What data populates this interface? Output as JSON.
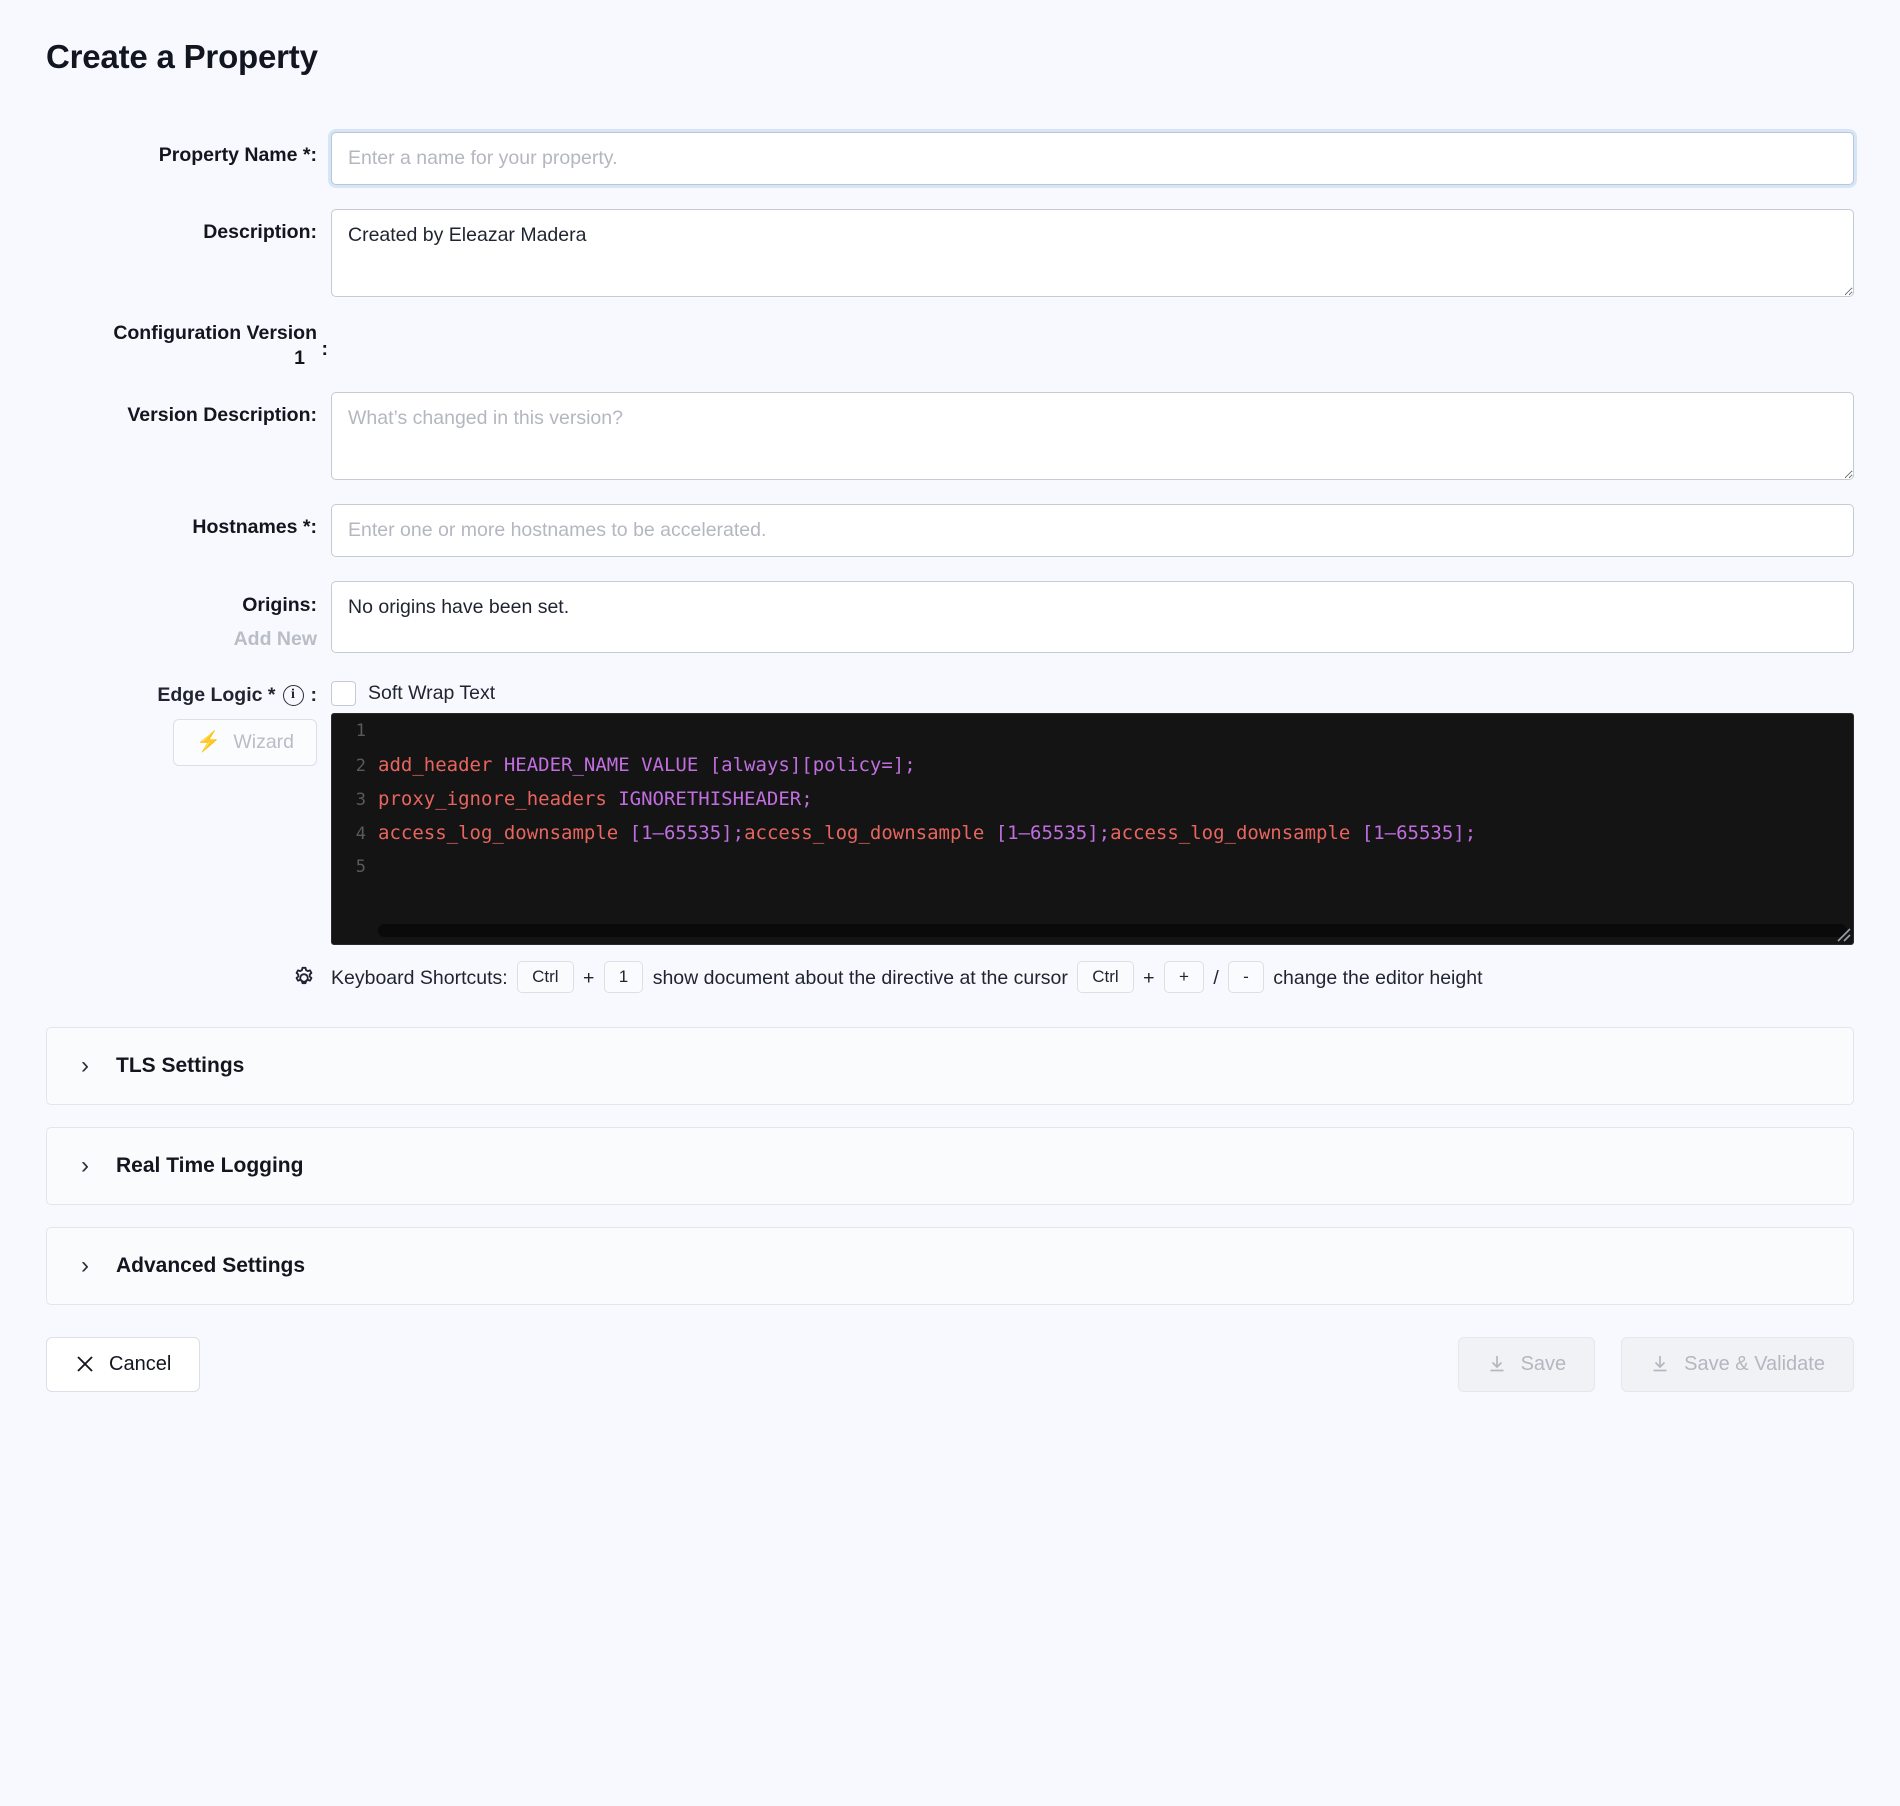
{
  "page": {
    "title": "Create a Property"
  },
  "form": {
    "property_name": {
      "label": "Property Name *",
      "colon": ":",
      "value": "",
      "placeholder": "Enter a name for your property."
    },
    "description": {
      "label": "Description",
      "colon": ":",
      "value": "Created by Eleazar Madera",
      "placeholder": ""
    },
    "configuration_version": {
      "label": "Configuration Version",
      "colon": ":",
      "value": "1"
    },
    "version_description": {
      "label": "Version Description",
      "colon": ":",
      "value": "",
      "placeholder": "What’s changed in this version?"
    },
    "hostnames": {
      "label": "Hostnames *",
      "colon": ":",
      "value": "",
      "placeholder": "Enter one or more hostnames to be accelerated."
    },
    "origins": {
      "label": "Origins",
      "colon": ":",
      "add_new": "Add New",
      "empty_text": "No origins have been set."
    },
    "edge_logic": {
      "label": "Edge Logic *",
      "colon": ":",
      "info_icon": "info-icon",
      "soft_wrap_label": "Soft Wrap Text",
      "soft_wrap_checked": false,
      "wizard_label": "Wizard",
      "wizard_icon": "lightning-bolt-icon",
      "wizard_disabled": true
    }
  },
  "editor": {
    "lines": [
      {
        "num": "1",
        "tokens": []
      },
      {
        "num": "2",
        "tokens": [
          {
            "t": "add_header ",
            "c": "dir"
          },
          {
            "t": "HEADER_NAME VALUE [always][policy=];",
            "c": "arg"
          }
        ]
      },
      {
        "num": "3",
        "tokens": [
          {
            "t": "proxy_ignore_headers ",
            "c": "dir"
          },
          {
            "t": "IGNORETHISHEADER;",
            "c": "arg"
          }
        ]
      },
      {
        "num": "4",
        "tokens": [
          {
            "t": "access_log_downsample ",
            "c": "dir"
          },
          {
            "t": "[1–65535];",
            "c": "arg"
          },
          {
            "t": "access_log_downsample ",
            "c": "dir"
          },
          {
            "t": "[1–65535];",
            "c": "arg"
          },
          {
            "t": "access_log_downsample ",
            "c": "dir"
          },
          {
            "t": "[1–65535];",
            "c": "arg"
          }
        ]
      },
      {
        "num": "5",
        "tokens": []
      }
    ],
    "colors": {
      "background": "#141414",
      "directive": "#e8655f",
      "argument": "#c06ee0",
      "gutter": "#5a5a5a"
    }
  },
  "shortcuts": {
    "gear_icon": "gear-icon",
    "prefix": "Keyboard Shortcuts:",
    "key_ctrl_1_a": "Ctrl",
    "plus_a": "+",
    "key_1": "1",
    "desc_a": "show document about the directive at the cursor",
    "key_ctrl_2": "Ctrl",
    "plus_b": "+",
    "key_plus": "+",
    "slash": "/",
    "key_minus": "-",
    "desc_b": "change the editor height"
  },
  "accordions": [
    {
      "label": "TLS Settings",
      "icon": "chevron-right-icon",
      "expanded": false
    },
    {
      "label": "Real Time Logging",
      "icon": "chevron-right-icon",
      "expanded": false
    },
    {
      "label": "Advanced Settings",
      "icon": "chevron-right-icon",
      "expanded": false
    }
  ],
  "footer": {
    "cancel": {
      "label": "Cancel",
      "icon": "close-x-icon",
      "disabled": false
    },
    "save": {
      "label": "Save",
      "icon": "download-icon",
      "disabled": true
    },
    "save_validate": {
      "label": "Save & Validate",
      "icon": "download-icon",
      "disabled": true
    }
  },
  "colors": {
    "page_background": "#f8f9fe",
    "focus_ring": "#d6e6f7",
    "text_primary": "#13161f",
    "text_muted": "#b3b7bf"
  }
}
